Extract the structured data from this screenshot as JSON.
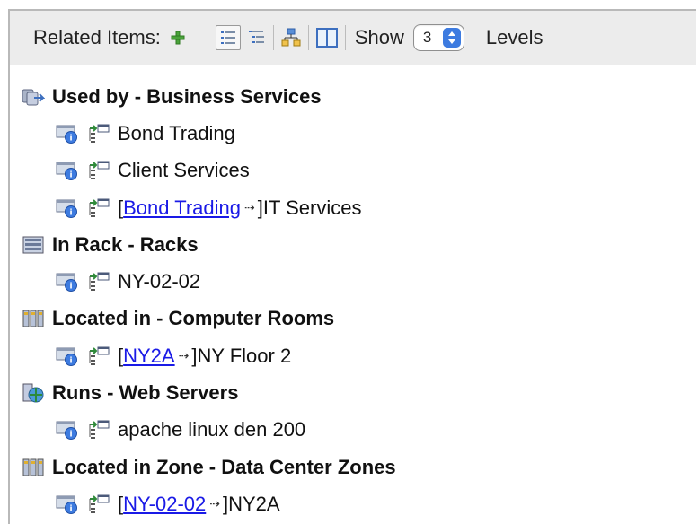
{
  "toolbar": {
    "related_label": "Related Items:",
    "show_label": "Show",
    "levels_value": "3",
    "levels_label": "Levels"
  },
  "groups": [
    {
      "title": "Used by - Business Services",
      "icon": "business-services-icon",
      "items": [
        {
          "prefix": "",
          "link": "",
          "arrow": "",
          "text": "Bond Trading"
        },
        {
          "prefix": "",
          "link": "",
          "arrow": "",
          "text": "Client Services"
        },
        {
          "prefix": "[",
          "link": "Bond Trading",
          "arrow": "⇢",
          "text": "]IT Services"
        }
      ]
    },
    {
      "title": "In Rack - Racks",
      "icon": "rack-icon",
      "items": [
        {
          "prefix": "",
          "link": "",
          "arrow": "",
          "text": "NY-02-02"
        }
      ]
    },
    {
      "title": "Located in - Computer Rooms",
      "icon": "computer-room-icon",
      "items": [
        {
          "prefix": "[",
          "link": "NY2A",
          "arrow": "⇢",
          "text": "]NY Floor 2"
        }
      ]
    },
    {
      "title": "Runs - Web Servers",
      "icon": "web-server-icon",
      "items": [
        {
          "prefix": "",
          "link": "",
          "arrow": "",
          "text": "apache linux den 200"
        }
      ]
    },
    {
      "title": "Located in Zone - Data Center Zones",
      "icon": "data-center-zone-icon",
      "items": [
        {
          "prefix": "[",
          "link": "NY-02-02",
          "arrow": "⇢",
          "text": "]NY2A"
        }
      ]
    }
  ]
}
